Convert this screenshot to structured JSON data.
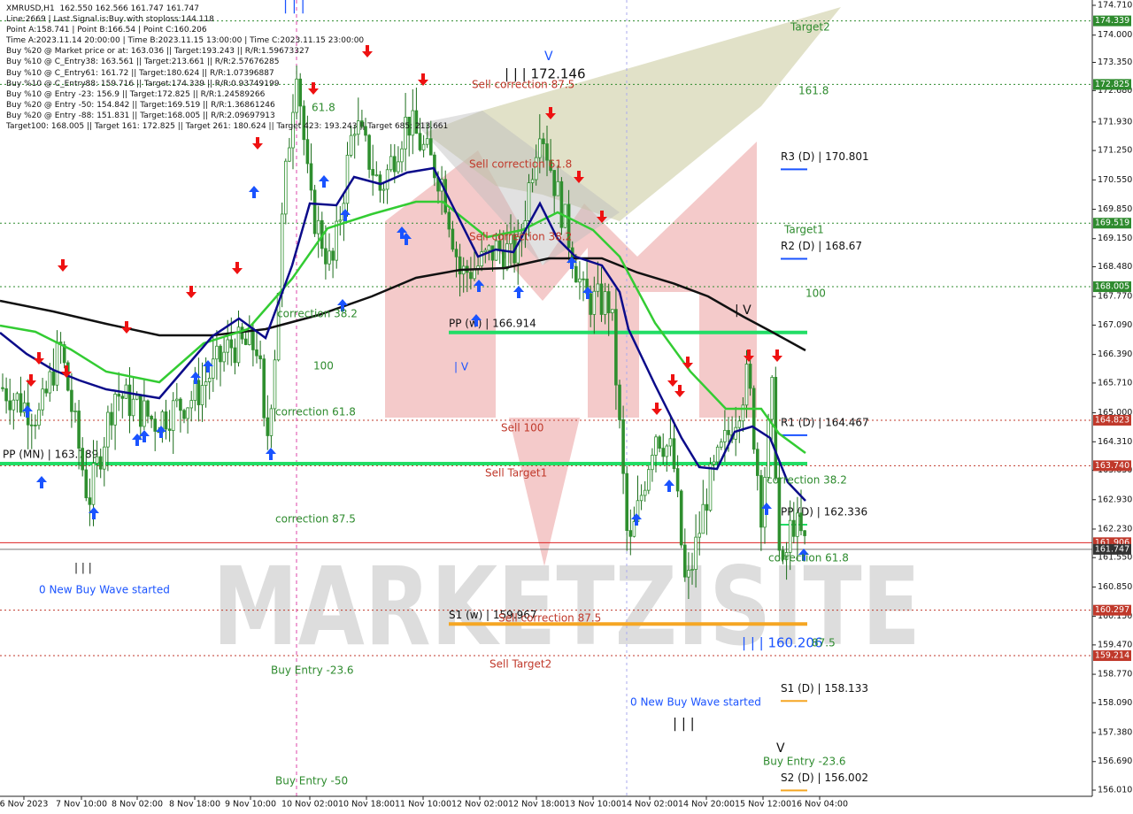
{
  "colors": {
    "background": "#ffffff",
    "candle_body": "#2f8f2f",
    "candle_wick": "#1b6d1b",
    "ma_fast": "#0b0b8a",
    "ma_mid": "#33cc33",
    "ma_slow": "#111111",
    "pivot_line": "#22dd66",
    "support_line": "#f5a623",
    "buy_arrow": "#1a53ff",
    "sell_arrow": "#ee1111",
    "level_green": "#2e8b2e",
    "level_red": "#c0392b",
    "watermark": "#d8d8d8"
  },
  "info_panel": [
    "XMRUSD,H1  162.550 162.566 161.747 161.747",
    "Line:2669 | Last Signal is:Buy with stoploss:144.118",
    "Point A:158.741 | Point B:166.54 | Point C:160.206",
    "Time A:2023.11.14 20:00:00 | Time B:2023.11.15 13:00:00 | Time C:2023.11.15 23:00:00",
    "Buy %20 @ Market price or at: 163.036 || Target:193.243 || R/R:1.59673327",
    "Buy %10 @ C_Entry38: 163.561 || Target:213.661 || R/R:2.57676285",
    "Buy %10 @ C_Entry61: 161.72 || Target:180.624 || R/R:1.07396887",
    "Buy %10 @ C_Entry88: 159.716 || Target:174.339 || R/R:0.93749199",
    "Buy %10 @ Entry -23: 156.9 || Target:172.825 || R/R:1.24589266",
    "Buy %20 @ Entry -50: 154.842 || Target:169.519 || R/R:1.36861246",
    "Buy %20 @ Entry -88: 151.831 || Target:168.005 || R/R:2.09697913",
    "Target100: 168.005 || Target 161: 172.825 || Target 261: 180.624 || Target 423: 193.243 || Target 685: 213.661"
  ],
  "chart_data": {
    "type": "candlestick",
    "symbol": "XMRUSD",
    "timeframe": "H1",
    "ylim": [
      156.0,
      174.7
    ],
    "y_ticks": [
      "174.710",
      "174.000",
      "173.350",
      "172.680",
      "171.930",
      "171.250",
      "170.550",
      "169.850",
      "169.150",
      "168.480",
      "167.770",
      "167.090",
      "166.390",
      "165.710",
      "165.000",
      "164.310",
      "163.630",
      "162.930",
      "162.230",
      "161.550",
      "160.850",
      "160.150",
      "159.470",
      "158.770",
      "158.090",
      "157.380",
      "156.690",
      "156.010"
    ],
    "x_ticks": [
      "6 Nov 2023",
      "7 Nov 10:00",
      "8 Nov 02:00",
      "8 Nov 18:00",
      "9 Nov 10:00",
      "10 Nov 02:00",
      "10 Nov 18:00",
      "11 Nov 10:00",
      "12 Nov 02:00",
      "12 Nov 18:00",
      "13 Nov 10:00",
      "14 Nov 02:00",
      "14 Nov 20:00",
      "15 Nov 12:00",
      "16 Nov 04:00"
    ],
    "price_tags": [
      {
        "value": 174.339,
        "label": "174.339",
        "color": "#2e8b2e"
      },
      {
        "value": 172.825,
        "label": "172.825",
        "color": "#2e8b2e"
      },
      {
        "value": 169.519,
        "label": "169.519",
        "color": "#2e8b2e"
      },
      {
        "value": 168.005,
        "label": "168.005",
        "color": "#2e8b2e"
      },
      {
        "value": 164.823,
        "label": "164.823",
        "color": "#c0392b"
      },
      {
        "value": 163.74,
        "label": "163.740",
        "color": "#c0392b"
      },
      {
        "value": 161.906,
        "label": "161.906",
        "color": "#c0392b"
      },
      {
        "value": 161.747,
        "label": "161.747",
        "color": "#333333"
      },
      {
        "value": 160.297,
        "label": "160.297",
        "color": "#c0392b"
      },
      {
        "value": 159.214,
        "label": "159.214",
        "color": "#c0392b"
      }
    ],
    "levels": [
      {
        "label": "PP (MN) | 163.789",
        "value": 163.789,
        "color": "#22dd66"
      },
      {
        "label": "PP (w) | 166.914",
        "value": 166.914,
        "color": "#22dd66"
      },
      {
        "label": "S1 (w) | 159.967",
        "value": 159.967,
        "color": "#f5a623"
      },
      {
        "label": "R3 (D) | 170.801",
        "value": 170.801,
        "color": "#1a53ff"
      },
      {
        "label": "R2 (D) | 168.67",
        "value": 168.67,
        "color": "#1a53ff"
      },
      {
        "label": "R1 (D) | 164.467",
        "value": 164.467,
        "color": "#1a53ff"
      },
      {
        "label": "PP (D) | 162.336",
        "value": 162.336,
        "color": "#22dd66"
      },
      {
        "label": "S1 (D) | 158.133",
        "value": 158.133,
        "color": "#f5a623"
      },
      {
        "label": "S2 (D) | 156.002",
        "value": 156.002,
        "color": "#f5a623"
      }
    ],
    "annotations": [
      {
        "text": "Target2",
        "color": "#2e8b2e"
      },
      {
        "text": "161.8",
        "color": "#2e8b2e"
      },
      {
        "text": "Target1",
        "color": "#2e8b2e"
      },
      {
        "text": "100",
        "color": "#2e8b2e"
      },
      {
        "text": "| | | 172.146",
        "color": "#111111"
      },
      {
        "text": "Sell correction 87.5",
        "color": "#c0392b"
      },
      {
        "text": "Sell correction 61.8",
        "color": "#c0392b"
      },
      {
        "text": "Sell correction 38.2",
        "color": "#c0392b"
      },
      {
        "text": "Sell 100",
        "color": "#c0392b"
      },
      {
        "text": "Sell Target1",
        "color": "#c0392b"
      },
      {
        "text": "Sell Target2",
        "color": "#c0392b"
      },
      {
        "text": "correction 38.2",
        "color": "#2e8b2e"
      },
      {
        "text": "correction 61.8",
        "color": "#2e8b2e"
      },
      {
        "text": "correction 87.5",
        "color": "#2e8b2e"
      },
      {
        "text": "Buy Entry -23.6",
        "color": "#2e8b2e"
      },
      {
        "text": "Buy Entry -50",
        "color": "#2e8b2e"
      },
      {
        "text": "0 New Buy Wave started",
        "color": "#1a53ff"
      },
      {
        "text": "| | | 160.206",
        "color": "#1a53ff"
      },
      {
        "text": "61.8",
        "color": "#2e8b2e"
      },
      {
        "text": "87.5",
        "color": "#2e8b2e"
      },
      {
        "text": "| V",
        "color": "#1a53ff"
      },
      {
        "text": "| | |",
        "color": "#111111"
      }
    ],
    "watermark": "MARKETZISITE"
  }
}
